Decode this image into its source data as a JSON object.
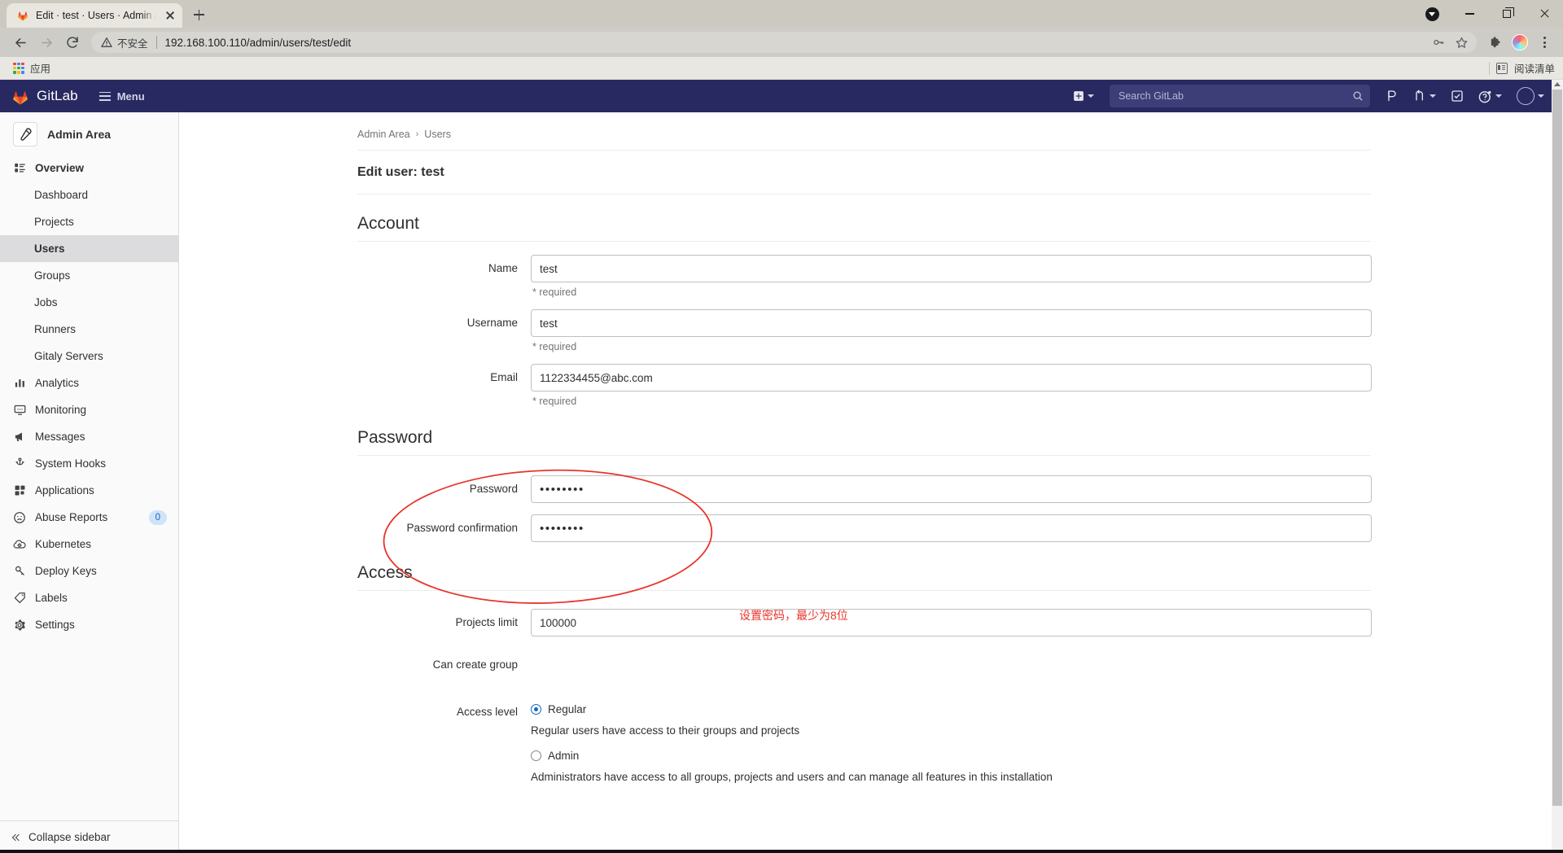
{
  "browser": {
    "tab": {
      "title": "Edit · test · Users · Admin Area",
      "favicon_name": "gitlab-favicon"
    },
    "newtab_label": "+",
    "window": {
      "record_label": "recording-indicator",
      "minimize": "Minimize",
      "maximize": "Maximize",
      "close": "Close"
    },
    "omnibox": {
      "not_secure": "不安全",
      "url": "192.168.100.110/admin/users/test/edit"
    },
    "bookmarks": {
      "apps_label": "应用",
      "reading_list_label": "阅读清单"
    }
  },
  "gitlab": {
    "brand": "GitLab",
    "menu_label": "Menu",
    "search_placeholder": "Search GitLab",
    "nav_icons": [
      "plus-square-icon",
      "issues-icon",
      "merge-requests-icon",
      "todos-icon",
      "help-icon",
      "user-avatar"
    ],
    "sidebar": {
      "context_title": "Admin Area",
      "groups": [
        {
          "label": "Overview",
          "icon": "overview-icon",
          "children": [
            {
              "label": "Dashboard",
              "active": false
            },
            {
              "label": "Projects",
              "active": false
            },
            {
              "label": "Users",
              "active": true
            },
            {
              "label": "Groups",
              "active": false
            },
            {
              "label": "Jobs",
              "active": false
            },
            {
              "label": "Runners",
              "active": false
            },
            {
              "label": "Gitaly Servers",
              "active": false
            }
          ]
        }
      ],
      "items": [
        {
          "label": "Analytics",
          "icon": "analytics-icon",
          "badge": null
        },
        {
          "label": "Monitoring",
          "icon": "monitoring-icon",
          "badge": null
        },
        {
          "label": "Messages",
          "icon": "messages-icon",
          "badge": null
        },
        {
          "label": "System Hooks",
          "icon": "system-hooks-icon",
          "badge": null
        },
        {
          "label": "Applications",
          "icon": "applications-icon",
          "badge": null
        },
        {
          "label": "Abuse Reports",
          "icon": "abuse-reports-icon",
          "badge": "0"
        },
        {
          "label": "Kubernetes",
          "icon": "kubernetes-icon",
          "badge": null
        },
        {
          "label": "Deploy Keys",
          "icon": "deploy-keys-icon",
          "badge": null
        },
        {
          "label": "Labels",
          "icon": "labels-icon",
          "badge": null
        },
        {
          "label": "Settings",
          "icon": "settings-icon",
          "badge": null
        }
      ],
      "collapse_label": "Collapse sidebar"
    }
  },
  "page": {
    "breadcrumb": {
      "root": "Admin Area",
      "separator": "›",
      "current": "Users"
    },
    "title": "Edit user: test",
    "sections": {
      "account": {
        "heading": "Account",
        "fields": [
          {
            "label": "Name",
            "value": "test",
            "help": "* required",
            "type": "text"
          },
          {
            "label": "Username",
            "value": "test",
            "help": "* required",
            "type": "text"
          },
          {
            "label": "Email",
            "value": "1122334455@abc.com",
            "help": "* required",
            "type": "text"
          }
        ]
      },
      "password": {
        "heading": "Password",
        "fields": [
          {
            "label": "Password",
            "value": "••••••••",
            "type": "password"
          },
          {
            "label": "Password confirmation",
            "value": "••••••••",
            "type": "password"
          }
        ]
      },
      "access": {
        "heading": "Access",
        "projects_limit": {
          "label": "Projects limit",
          "value": "100000"
        },
        "can_create_group": {
          "label": "Can create group",
          "checked": true
        },
        "access_level": {
          "label": "Access level",
          "options": [
            {
              "label": "Regular",
              "selected": true,
              "description": "Regular users have access to their groups and projects"
            },
            {
              "label": "Admin",
              "selected": false,
              "description": "Administrators have access to all groups, projects and users and can manage all features in this installation"
            }
          ]
        }
      }
    }
  },
  "annotation": {
    "color": "#e8342a",
    "text": "设置密码，最少为8位",
    "shape": "ellipse-highlight"
  }
}
